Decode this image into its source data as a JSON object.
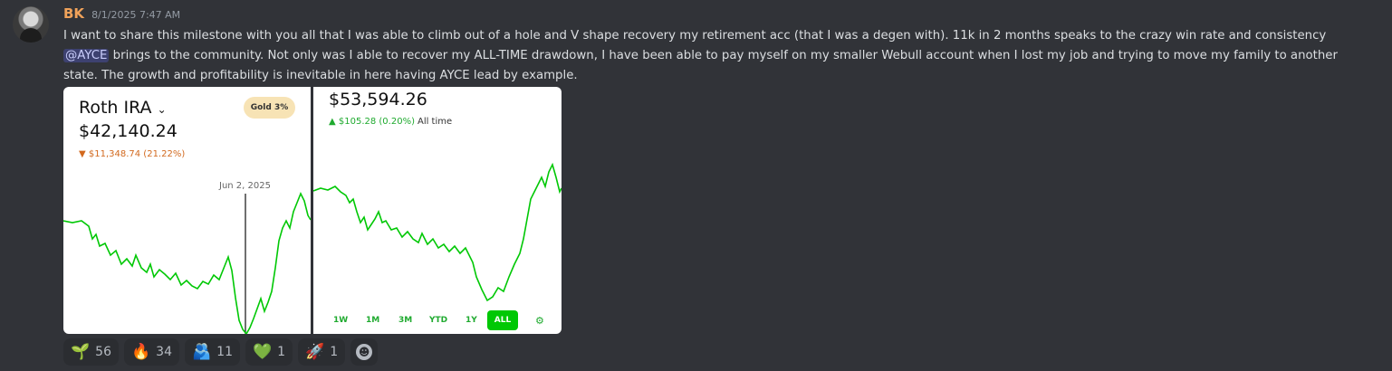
{
  "author": {
    "username": "BK",
    "timestamp": "8/1/2025 7:47 AM"
  },
  "message": {
    "part1": "I want to share this milestone with you all that I was able to climb out of a hole and V shape recovery my retirement acc (that I was a degen with). 11k in 2 months speaks to the crazy win rate and consistency\n",
    "mention": "@AYCE",
    "part2": " brings to the community. Not only was I able to recover my ALL-TIME drawdown, I have been able to pay myself on my smaller Webull account when I lost my job and trying to move my family to another state. The growth and profitability is inevitable in here having AYCE lead by example."
  },
  "attachment1": {
    "account_name": "Roth IRA",
    "dropdown_icon": "chevron-down-icon",
    "value": "$42,140.24",
    "change": "▼ $11,348.74 (21.22%)",
    "badge": "Gold 3%",
    "date_label": "Jun 2, 2025",
    "line_color": "#00c805",
    "change_color": "#d2691e"
  },
  "attachment2": {
    "value": "$53,594.26",
    "change": "▲ $105.28 (0.20%)",
    "change_suffix": "All time",
    "timeframes": [
      "1W",
      "1M",
      "3M",
      "YTD",
      "1Y",
      "ALL"
    ],
    "active_timeframe": "ALL",
    "settings_icon": "gear-icon",
    "line_color": "#00c805"
  },
  "reactions": [
    {
      "emoji": "🌱",
      "count": "56",
      "icon": "seedling-icon"
    },
    {
      "emoji": "🔥",
      "count": "34",
      "icon": "fire-icon"
    },
    {
      "emoji": "🫂",
      "count": "11",
      "icon": "people-hugging-icon"
    },
    {
      "emoji": "💚",
      "count": "1",
      "icon": "green-heart-icon"
    },
    {
      "emoji": "🚀",
      "count": "1",
      "icon": "rocket-icon"
    }
  ],
  "add_reaction_icon": "smiley-add-icon"
}
